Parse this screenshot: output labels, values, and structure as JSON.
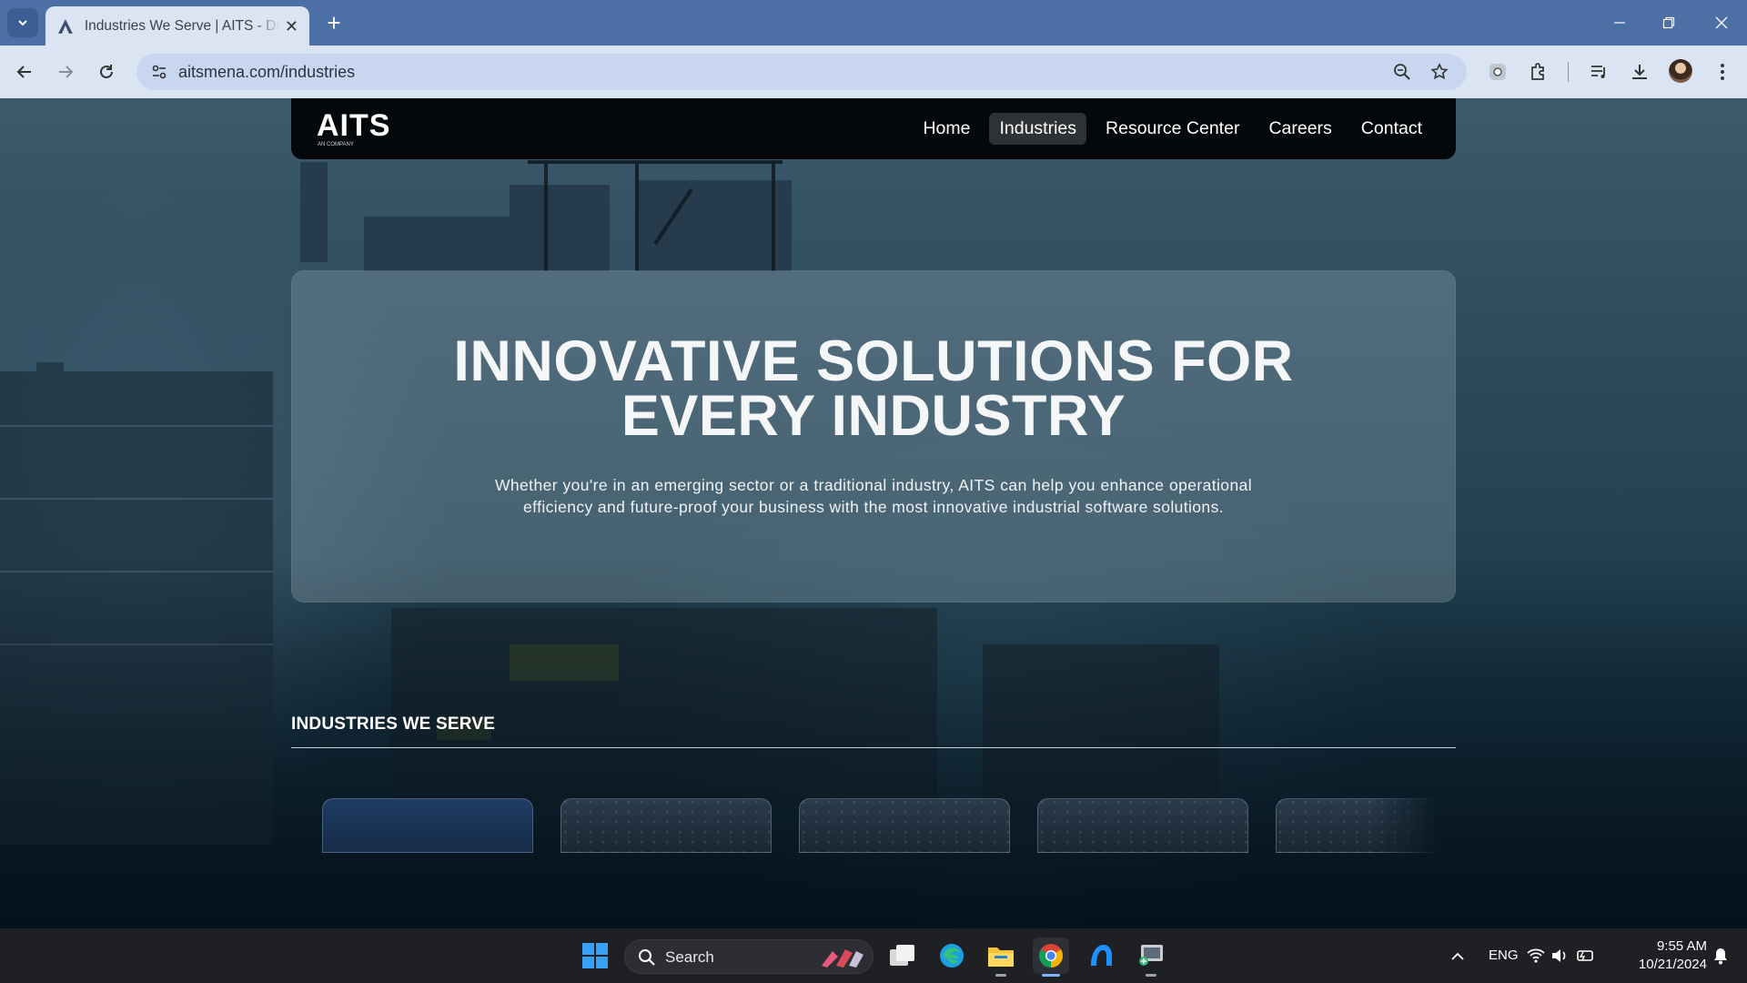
{
  "browser": {
    "tab_title": "Industries We Serve | AITS - Dri",
    "url": "aitsmena.com/industries"
  },
  "site": {
    "logo_text": "AITS",
    "logo_tagline": "AN COMPANY",
    "nav": [
      {
        "label": "Home",
        "active": false
      },
      {
        "label": "Industries",
        "active": true
      },
      {
        "label": "Resource Center",
        "active": false
      },
      {
        "label": "Careers",
        "active": false
      },
      {
        "label": "Contact",
        "active": false
      }
    ]
  },
  "hero": {
    "title_line1": "INNOVATIVE SOLUTIONS FOR",
    "title_line2": "EVERY INDUSTRY",
    "description": "Whether you're in an emerging sector or a traditional industry, AITS can help you enhance operational efficiency and future-proof your business with the most innovative industrial software solutions."
  },
  "industries": {
    "section_title": "INDUSTRIES WE SERVE"
  },
  "taskbar": {
    "search_placeholder": "Search",
    "language": "ENG",
    "time": "9:55 AM",
    "date": "10/21/2024"
  },
  "colors": {
    "tabstrip": "#4c6fa6",
    "toolbar": "#dbe4f3",
    "site_nav": "#05080a",
    "taskbar": "#1f2024"
  }
}
